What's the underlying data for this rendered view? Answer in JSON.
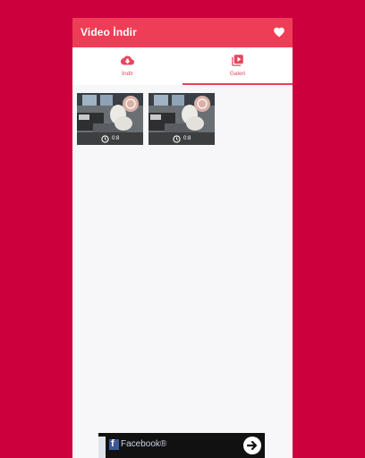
{
  "app": {
    "title": "Video İndir",
    "accent": "#ee3d56",
    "background": "#cc003d"
  },
  "header": {
    "favorites_icon": "heart-icon"
  },
  "tabs": [
    {
      "label": "İndir",
      "icon": "cloud-download-icon",
      "selected": false
    },
    {
      "label": "Galeri",
      "icon": "video-library-icon",
      "selected": true
    }
  ],
  "gallery": {
    "items": [
      {
        "duration": "0:8"
      },
      {
        "duration": "0:8"
      }
    ]
  },
  "ad": {
    "text": "Facebook®",
    "icon": "arrow-right-icon"
  }
}
